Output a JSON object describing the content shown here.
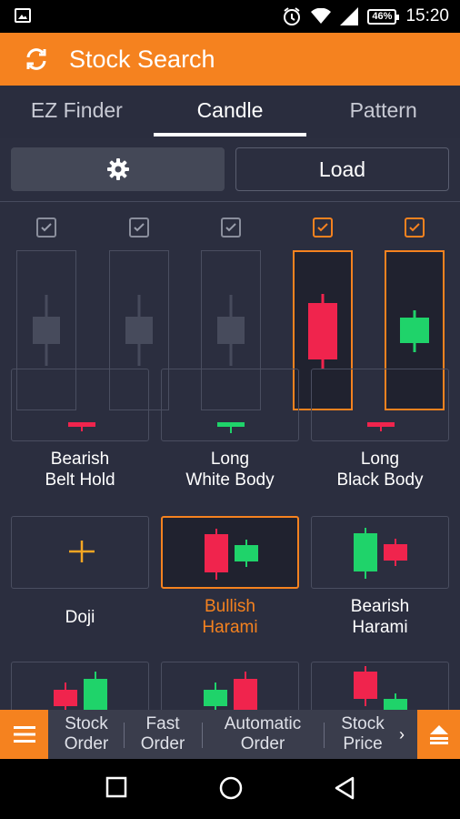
{
  "status_bar": {
    "time": "15:20",
    "battery": "46%",
    "icons": [
      "image-icon",
      "alarm-icon",
      "wifi-icon",
      "signal-icon",
      "battery-icon"
    ]
  },
  "header": {
    "title": "Stock Search",
    "refresh_icon": "refresh-icon"
  },
  "tabs": [
    {
      "label": "EZ Finder",
      "active": false
    },
    {
      "label": "Candle",
      "active": true
    },
    {
      "label": "Pattern",
      "active": false
    }
  ],
  "toolbar": {
    "settings_icon": "gear-icon",
    "load_label": "Load"
  },
  "candle_slots": [
    {
      "checked": false,
      "state": "empty"
    },
    {
      "checked": false,
      "state": "empty"
    },
    {
      "checked": false,
      "state": "empty"
    },
    {
      "checked": true,
      "state": "bearish"
    },
    {
      "checked": true,
      "state": "bullish"
    }
  ],
  "patterns": [
    {
      "label": "Bearish\nBelt Hold",
      "selected": false
    },
    {
      "label": "Long\nWhite Body",
      "selected": false
    },
    {
      "label": "Long\nBlack Body",
      "selected": false
    },
    {
      "label": "Doji",
      "selected": false
    },
    {
      "label": "Bullish\nHarami",
      "selected": true
    },
    {
      "label": "Bearish\nHarami",
      "selected": false
    },
    {
      "label": "",
      "selected": false
    },
    {
      "label": "",
      "selected": false
    },
    {
      "label": "",
      "selected": false
    }
  ],
  "bottom_nav": {
    "menu_icon": "hamburger-icon",
    "items": [
      "Stock\nOrder",
      "Fast\nOrder",
      "Automatic\nOrder",
      "Stock\nPrice"
    ],
    "more_icon": "chevron-right-icon",
    "eject_icon": "eject-icon"
  },
  "system_nav": [
    "recent-apps-icon",
    "home-icon",
    "back-icon"
  ],
  "colors": {
    "accent": "#f5821f",
    "bearish": "#f0244d",
    "bullish": "#1fd36a",
    "doji": "#f5a623",
    "background": "#2b2e3f"
  }
}
